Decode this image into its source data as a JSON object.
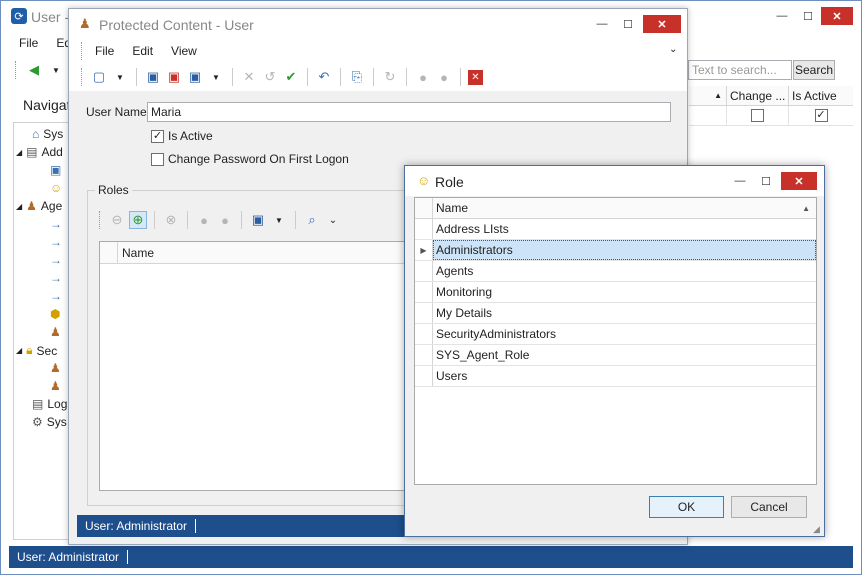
{
  "main": {
    "title": "User -",
    "menu": [
      "File",
      "Ed"
    ],
    "search_placeholder": "Text to search...",
    "search_button": "Search",
    "nav_header": "Navigat",
    "nav_items": [
      "Sys",
      "Add",
      "",
      "",
      "Age",
      "",
      "",
      "",
      "",
      "",
      "",
      "Sec",
      "",
      "",
      "Log",
      "Sys"
    ],
    "grid_headers": {
      "change": "Change ...",
      "is_active": "Is Active"
    },
    "status": "User: Administrator"
  },
  "protected": {
    "title": "Protected Content - User",
    "menu": [
      "File",
      "Edit",
      "View"
    ],
    "user_name_label": "User Name:",
    "user_name_value": "Maria",
    "is_active_label": "Is Active",
    "change_password_label": "Change Password On First Logon",
    "roles_label": "Roles",
    "roles_grid_header": "Name",
    "status": "User: Administrator"
  },
  "role_dialog": {
    "title": "Role",
    "column_header": "Name",
    "rows": [
      "Address LIsts",
      "Administrators",
      "Agents",
      "Monitoring",
      "My Details",
      "SecurityAdministrators",
      "SYS_Agent_Role",
      "Users"
    ],
    "selected_index": 1,
    "ok": "OK",
    "cancel": "Cancel"
  },
  "colors": {
    "status_bar": "#1e4e8c",
    "close_button": "#c7312a",
    "selection": "#cde3f7"
  }
}
